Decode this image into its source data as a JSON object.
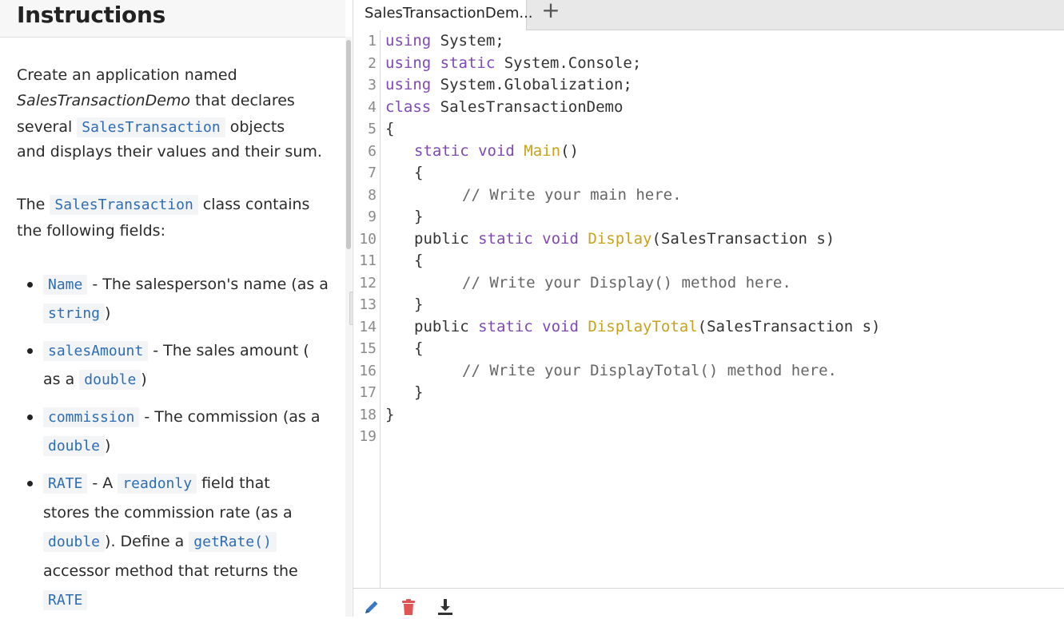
{
  "instructions": {
    "title": "Instructions",
    "p1": {
      "l1": "Create an application named",
      "l2_italic": "SalesTransactionDemo",
      "l2_rest": " that declares",
      "l3_pre": "several ",
      "l3_code": "SalesTransaction",
      "l3_post": " objects",
      "l4": "and displays their values and their sum."
    },
    "p2": {
      "l1_pre": "The ",
      "l1_code": "SalesTransaction",
      "l1_post": " class contains",
      "l2": "the following fields:"
    },
    "bullets": [
      {
        "code": "Name",
        "text": " - The salesperson's name (as a",
        "code2": "string",
        "text2": ")"
      },
      {
        "code": "salesAmount",
        "text": " - The sales amount (",
        "text2_pre": "as a ",
        "code2": "double",
        "text2": ")"
      },
      {
        "code": "commission",
        "text": " - The commission (as a",
        "code2": "double",
        "text2": ")"
      },
      {
        "code": "RATE",
        "text_pre": " - A ",
        "code_mid": "readonly",
        "text": " field that",
        "l2": "stores the commission rate (as a",
        "l3_code": "double",
        "l3_mid": "). Define a ",
        "l3_code2": "getRate()",
        "l4": "accessor method that returns the",
        "l5_code": "RATE"
      }
    ]
  },
  "editor": {
    "tab_label": "SalesTransactionDem...",
    "add_tab_symbol": "+",
    "line_numbers": [
      "1",
      "2",
      "3",
      "4",
      "5",
      "6",
      "7",
      "8",
      "9",
      "10",
      "11",
      "12",
      "13",
      "14",
      "15",
      "16",
      "17",
      "18",
      "19"
    ],
    "code": {
      "l1_kw": "using",
      "l1_rest": " System;",
      "l2_kw": "using static",
      "l2_rest": " System.Console;",
      "l3_kw": "using",
      "l3_rest": " System.Globalization;",
      "l4_kw": "class",
      "l4_rest": " SalesTransactionDemo",
      "l5": "{",
      "l6_kw": "static void",
      "l6_fn": "Main",
      "l6_rest": "()",
      "l7": "{",
      "l8_cm": "// Write your main here.",
      "l9": "}",
      "l10_pre": "public",
      "l10_kw": "static void",
      "l10_fn": "Display",
      "l10_rest": "(SalesTransaction s)",
      "l11": "{",
      "l12_cm": "// Write your Display() method here.",
      "l13": "}",
      "l14_pre": "public",
      "l14_kw": "static void",
      "l14_fn": "DisplayTotal",
      "l14_rest": "(SalesTransaction s)",
      "l15": "{",
      "l16_cm": "// Write your DisplayTotal() method here.",
      "l17": "}",
      "l18": "}"
    },
    "bottom_icons": [
      "pencil-icon",
      "trash-icon",
      "download-icon"
    ],
    "colors": {
      "keyword": "#7e48b5",
      "function": "#c7a21a",
      "comment": "#666666",
      "trash": "#e05454",
      "pencil": "#3a78c2"
    }
  }
}
